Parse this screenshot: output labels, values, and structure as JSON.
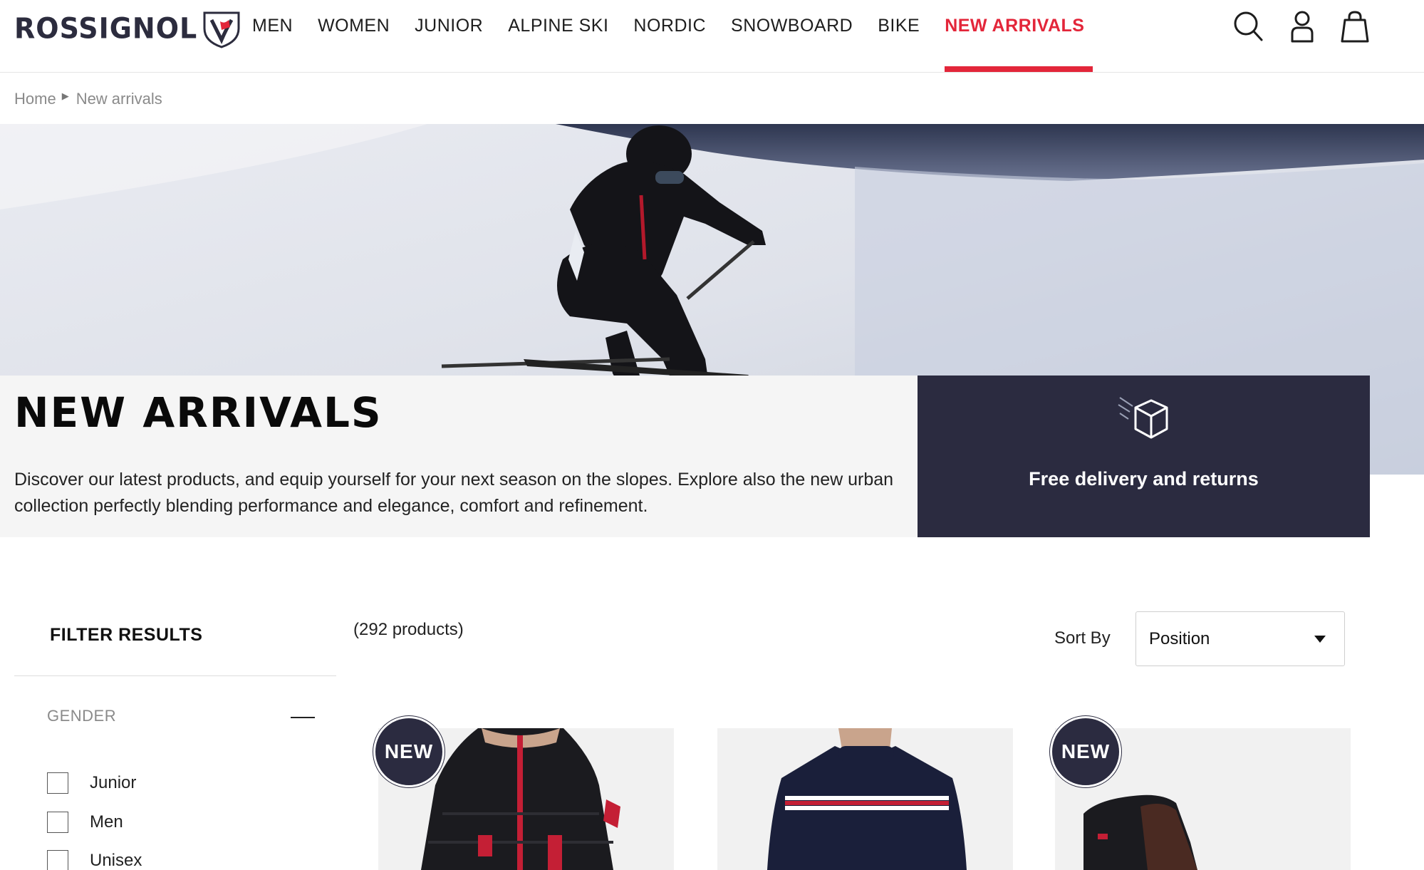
{
  "header": {
    "brand": "ROSSIGNOL",
    "nav": [
      {
        "label": "MEN",
        "active": false
      },
      {
        "label": "WOMEN",
        "active": false
      },
      {
        "label": "JUNIOR",
        "active": false
      },
      {
        "label": "ALPINE SKI",
        "active": false
      },
      {
        "label": "NORDIC",
        "active": false
      },
      {
        "label": "SNOWBOARD",
        "active": false
      },
      {
        "label": "BIKE",
        "active": false
      },
      {
        "label": "NEW ARRIVALS",
        "active": true
      }
    ],
    "icons": [
      "search-icon",
      "account-icon",
      "cart-icon"
    ]
  },
  "breadcrumb": {
    "items": [
      "Home",
      "New arrivals"
    ]
  },
  "hero": {
    "title": "NEW ARRIVALS",
    "description": "Discover our latest products, and equip yourself for your next season on the slopes. Explore also the new urban collection perfectly blending performance and elegance, comfort and refinement.",
    "delivery": {
      "icon": "package-icon",
      "text": "Free delivery and returns"
    }
  },
  "filters": {
    "title": "FILTER RESULTS",
    "groups": [
      {
        "label": "GENDER",
        "expanded": true,
        "options": [
          {
            "label": "Junior",
            "checked": false
          },
          {
            "label": "Men",
            "checked": false
          },
          {
            "label": "Unisex",
            "checked": false
          }
        ]
      }
    ]
  },
  "listing": {
    "count_text": "(292 products)",
    "sort_label": "Sort By",
    "sort_value": "Position",
    "badge_text": "NEW",
    "products": [
      {
        "badge": true,
        "image": "black-red-puffer-jacket"
      },
      {
        "badge": false,
        "image": "navy-striped-sweater"
      },
      {
        "badge": true,
        "image": "brown-boot"
      }
    ]
  },
  "colors": {
    "accent": "#e3263a",
    "navy": "#2b2b40"
  }
}
